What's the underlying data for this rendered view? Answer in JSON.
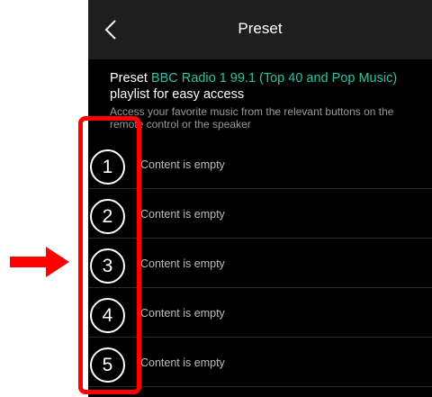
{
  "header": {
    "title": "Preset",
    "back_icon": "chevron-left-icon"
  },
  "intro": {
    "prefix": "Preset ",
    "station": "BBC Radio 1 99.1 (Top 40 and Pop Music)",
    "line2": "playlist for easy access",
    "description": "Access your favorite music from the relevant buttons on the remote control or the speaker"
  },
  "presets": [
    {
      "number": "1",
      "label": "Content is empty"
    },
    {
      "number": "2",
      "label": "Content is empty"
    },
    {
      "number": "3",
      "label": "Content is empty"
    },
    {
      "number": "4",
      "label": "Content is empty"
    },
    {
      "number": "5",
      "label": "Content is empty"
    }
  ],
  "colors": {
    "accent": "#25c7a5",
    "background": "#000000",
    "header_bg": "#1e1e1e",
    "annotation": "#ff0000"
  },
  "annotations": {
    "highlight": "red-box-around-preset-numbers",
    "pointer": "red-arrow-right-icon"
  }
}
